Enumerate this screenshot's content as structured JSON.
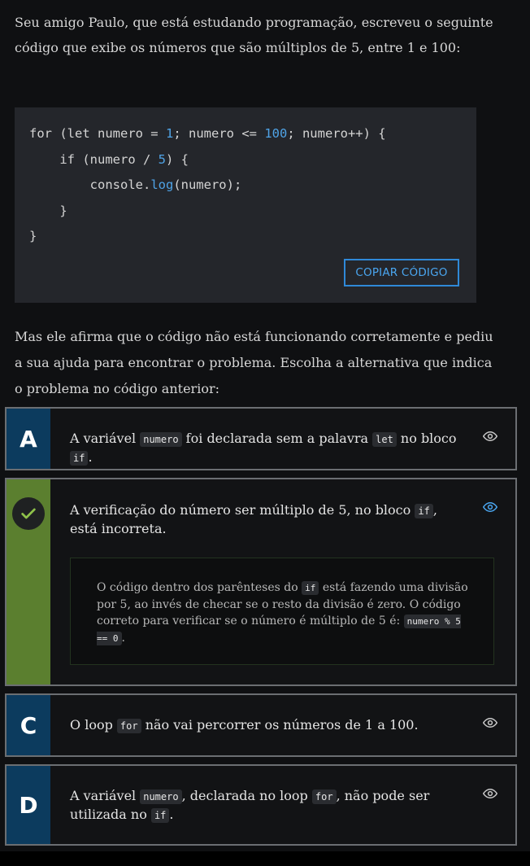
{
  "intro": "Seu amigo Paulo, que está estudando programação, escreveu o seguinte código que exibe os números que são múltiplos de 5, entre 1 e 100:",
  "code": {
    "line1_a": "for (let numero = ",
    "line1_n1": "1",
    "line1_b": "; numero <= ",
    "line1_n2": "100",
    "line1_c": "; numero++) {",
    "line2_a": "    if (numero / ",
    "line2_n": "5",
    "line2_b": ") {",
    "line3_a": "        console.",
    "line3_fn": "log",
    "line3_b": "(numero);",
    "line4": "    }",
    "line5": "}",
    "copy_label": "COPIAR CÓDIGO"
  },
  "question": "Mas ele afirma que o código não está funcionando corretamente e pediu a sua ajuda para encontrar o problema. Escolha a alternativa que indica o problema no código anterior:",
  "alternatives": {
    "a": {
      "letter": "A",
      "t1": "A variável ",
      "c1": "numero",
      "t2": " foi declarada sem a palavra ",
      "c2": "let",
      "t3": " no bloco ",
      "c3": "if",
      "t4": "."
    },
    "b": {
      "t1": "A verificação do número ser múltiplo de 5, no bloco ",
      "c1": "if",
      "t2": ", está incorreta.",
      "explain_t1": "O código dentro dos parênteses do ",
      "explain_c1": "if",
      "explain_t2": " está fazendo uma divisão por 5, ao invés de checar se o resto da divisão é zero. O código correto para verificar se o número é múltiplo de 5 é: ",
      "explain_c2": "numero % 5 == 0",
      "explain_t3": "."
    },
    "c": {
      "letter": "C",
      "t1": "O loop ",
      "c1": "for",
      "t2": " não vai percorrer os números de 1 a 100."
    },
    "d": {
      "letter": "D",
      "t1": "A variável ",
      "c1": "numero",
      "t2": ", declarada no loop ",
      "c2": "for",
      "t3": ", não pode ser utilizada no ",
      "c3": "if",
      "t4": "."
    }
  },
  "colors": {
    "letter_bg": "#0c3b5e",
    "correct_bg": "#5b7f2f",
    "accent": "#4aa6f0"
  },
  "icons": {
    "eye": "eye-icon",
    "check": "check-icon"
  }
}
